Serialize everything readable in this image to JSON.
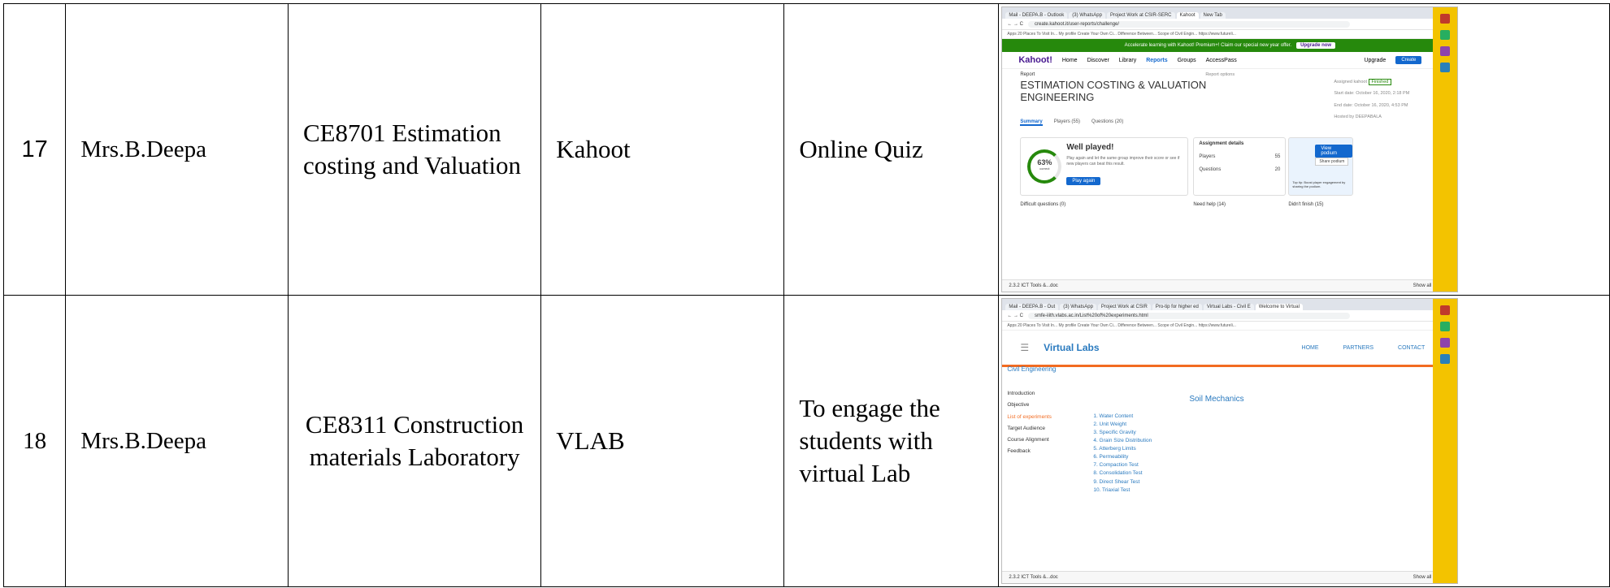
{
  "rows": [
    {
      "sno": "17",
      "faculty": "Mrs.B.Deepa",
      "course": "CE8701 Estimation costing and Valuation",
      "tool": "Kahoot",
      "method": "Online Quiz"
    },
    {
      "sno": "18",
      "faculty": "Mrs.B.Deepa",
      "course": "CE8311 Construction materials Laboratory",
      "tool": "VLAB",
      "method": "To engage the students with virtual Lab"
    }
  ],
  "kahoot": {
    "tabs": [
      "Mail - DEEPA.B - Outlook",
      "(3) WhatsApp",
      "Project Work at CSIR-SERC",
      "Kahoot",
      "New Tab"
    ],
    "url": "create.kahoot.it/user-reports/challenge/",
    "bookmarks": "Apps   20 Places To Visit In...   My profile   Create Your Own Ci...   Difference Between...   Scope of Civil Engin...   https://www.futureli...",
    "banner": "Accelerate learning with Kahoot! Premium+! Claim our special new year offer.",
    "banner_button": "Upgrade now",
    "logo": "Kahoot!",
    "nav": [
      "Home",
      "Discover",
      "Library",
      "Reports",
      "Groups",
      "AccessPass"
    ],
    "upgrade": "Upgrade",
    "create": "Create",
    "report_label": "Report",
    "report_options": "Report options",
    "title": "ESTIMATION COSTING & VALUATION ENGINEERING",
    "subtabs": [
      "Summary",
      "Players (55)",
      "Questions (20)"
    ],
    "assigned": "Assigned kahoot",
    "finished": "Finished",
    "start": "Start date: October 16, 2020, 2:18 PM",
    "end": "End date: October 16, 2020, 4:53 PM",
    "hosted": "Hosted by DEEPABALA",
    "score": "63%",
    "score_sub": "correct",
    "well": "Well played!",
    "well_text": "Play again and let the same group improve their score or see if new players can beat this result.",
    "play_again": "Play again",
    "assign_title": "Assignment details",
    "players_label": "Players",
    "players_val": "55",
    "questions_label": "Questions",
    "questions_val": "20",
    "view_podium": "View podium",
    "share_podium": "Share podium",
    "top_tip": "Top tip: Boost player engagement by sharing the podium.",
    "difficult": "Difficult questions (0)",
    "need_help": "Need help (14)",
    "didnt_finish": "Didn't finish (15)",
    "download": "2.3.2 ICT Tools &...doc",
    "show_all": "Show all"
  },
  "vlab": {
    "tabs": [
      "Mail - DEEPA.B - Out",
      "(3) WhatsApp",
      "Project Work at CSIR",
      "Pro-tip for higher ed",
      "Virtual Labs - Civil E",
      "Welcome to Virtual"
    ],
    "url": "smfe-iiith.vlabs.ac.in/List%20of%20experiments.html",
    "bookmarks": "Apps   20 Places To Visit In...   My profile   Create Your Own Ci...   Difference Between...   Scope of Civil Engin...   https://www.futureli...",
    "logo": "Virtual Labs",
    "nav": [
      "HOME",
      "PARTNERS",
      "CONTACT"
    ],
    "discipline": "Civil Engineering",
    "menu": [
      "Introduction",
      "Objective",
      "List of experiments",
      "Target Audience",
      "Course Alignment",
      "Feedback"
    ],
    "heading": "Soil Mechanics",
    "experiments": [
      "1. Water Content",
      "2. Unit Weight",
      "3. Specific Gravity",
      "4. Grain Size Distribution",
      "5. Atterberg Limits",
      "6. Permeability",
      "7. Compaction Test",
      "8. Consolidation Test",
      "9. Direct Shear Test",
      "10. Triaxial Test"
    ],
    "download": "2.3.2 ICT Tools &...doc",
    "show_all": "Show all"
  },
  "colors": {
    "kahoot_purple": "#46178f",
    "kahoot_blue": "#1368ce",
    "vlab_blue": "#2a7abf",
    "vlab_orange": "#f26b21",
    "taskbar_yellow": "#f3c300"
  }
}
